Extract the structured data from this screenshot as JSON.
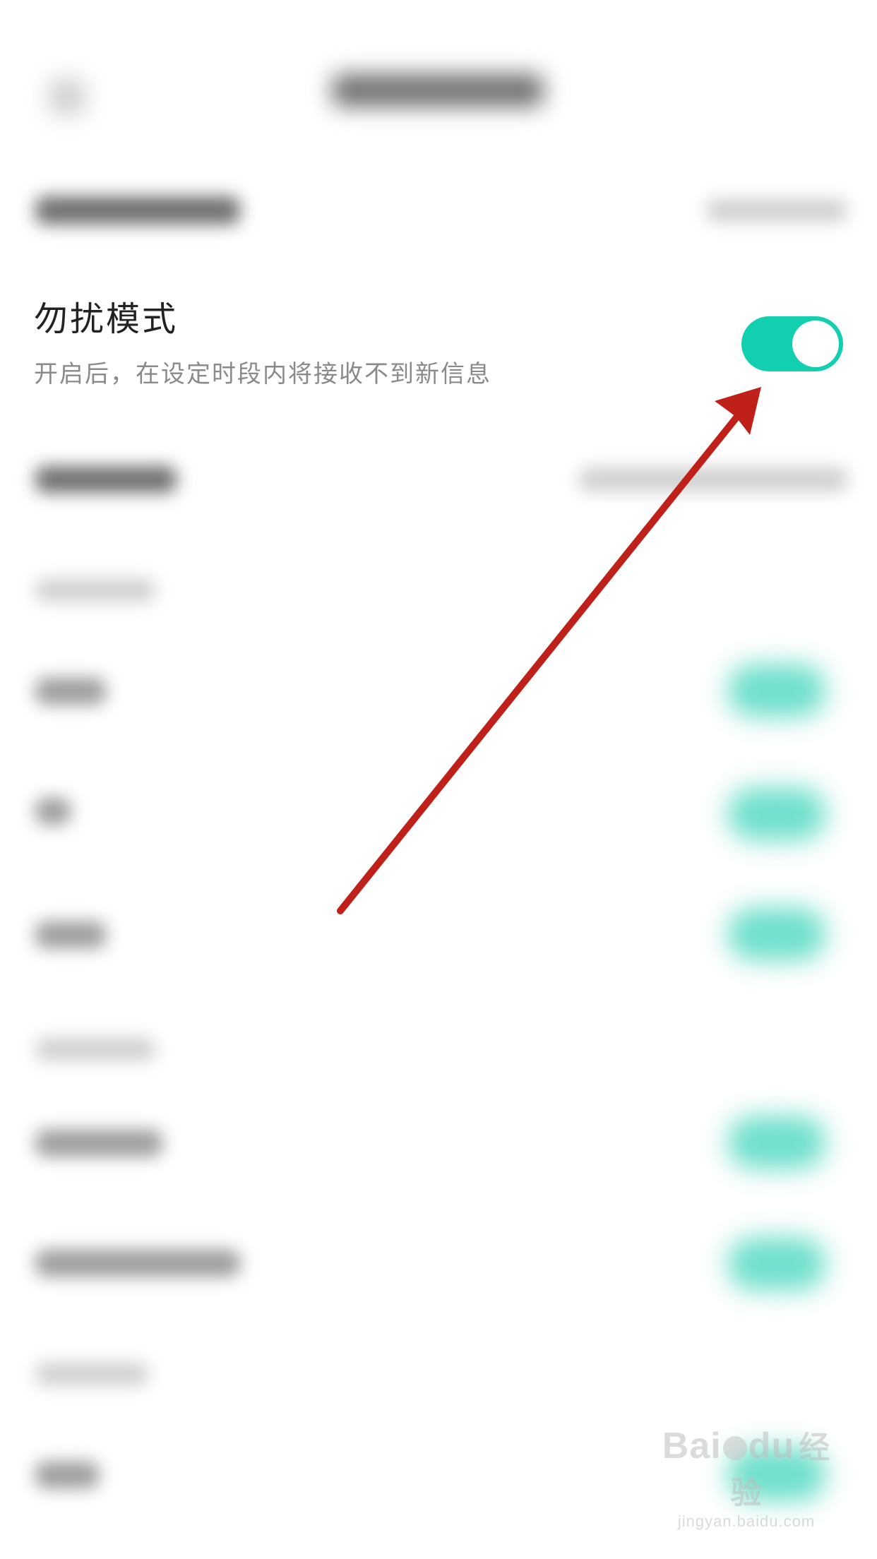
{
  "dnd": {
    "title": "勿扰模式",
    "description": "开启后，在设定时段内将接收不到新信息",
    "enabled": true,
    "accent_color": "#12cfb0"
  },
  "annotation": {
    "arrow_color": "#c0201a"
  },
  "watermark": {
    "brand_left": "Bai",
    "brand_right": "du",
    "brand_cn": "经验",
    "url": "jingyan.baidu.com"
  }
}
